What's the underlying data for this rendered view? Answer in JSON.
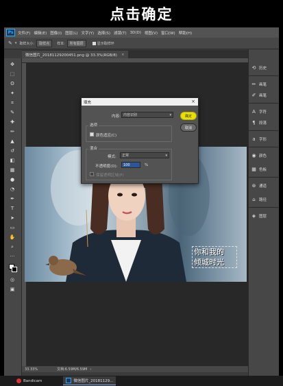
{
  "banner": {
    "text": "点击确定"
  },
  "menubar": {
    "logo": "Ps",
    "items": [
      "文件(F)",
      "编辑(E)",
      "图像(I)",
      "图层(L)",
      "文字(Y)",
      "选择(S)",
      "滤镜(T)",
      "3D(D)",
      "视图(V)",
      "窗口(W)",
      "帮助(H)"
    ]
  },
  "options": {
    "tolerance_label": "取样大小:",
    "tolerance_value": "取样点",
    "sample_label": "样本:",
    "sample_value": "所有图层",
    "show_ring_label": "显示取样环"
  },
  "document": {
    "tab_title": "微信图片_20181129200451.png @ 33.3%(RGB/8)",
    "zoom": "33.33%",
    "doc_size": "文档:6.59M/6.59M"
  },
  "dialog": {
    "title": "填充",
    "content_label": "内容:",
    "content_value": "内容识别",
    "options_title": "选项",
    "color_adapt_label": "颜色适应(C)",
    "blend_title": "混合",
    "mode_label": "模式:",
    "mode_value": "正常",
    "opacity_label": "不透明度(O):",
    "opacity_value": "100",
    "opacity_unit": "%",
    "preserve_label": "保留透明区域(P)",
    "ok_label": "确定",
    "cancel_label": "取消"
  },
  "watermark": {
    "line1": "你和我的",
    "line2": "倾城时光"
  },
  "panels": {
    "items": [
      "历史",
      "画笔",
      "画笔",
      "字符",
      "段落",
      "字形",
      "颜色",
      "色板",
      "通道",
      "路径",
      "图层"
    ]
  },
  "taskbar": {
    "items": [
      "Bandicam",
      "微信图片_20181129..."
    ]
  }
}
